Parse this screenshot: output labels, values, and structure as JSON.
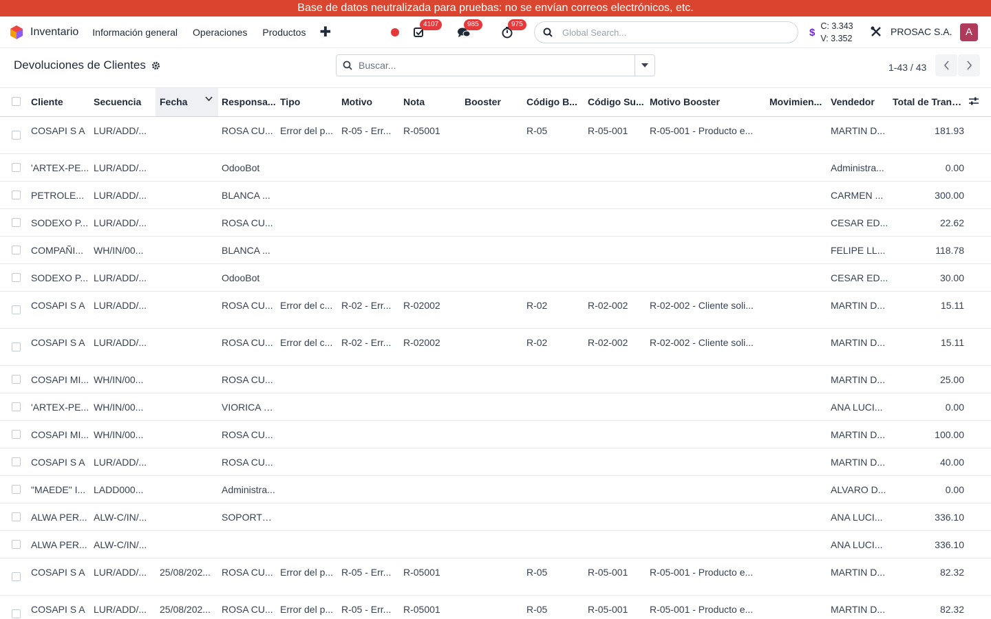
{
  "banner": "Base de datos neutralizada para pruebas: no se envían correos electrónicos, etc.",
  "navbar": {
    "app_name": "Inventario",
    "menu": [
      "Información general",
      "Operaciones",
      "Productos"
    ],
    "badges": {
      "activities": "4107",
      "messages": "985",
      "timesheets": "975"
    },
    "global_search_placeholder": "Global Search...",
    "rate_c": "C: 3.343",
    "rate_v": "V: 3.352",
    "company": "PROSAC S.A.",
    "avatar_letter": "A"
  },
  "control": {
    "title": "Devoluciones de Clientes",
    "search_placeholder": "Buscar...",
    "pager": "1-43 / 43"
  },
  "columns": [
    "Cliente",
    "Secuencia",
    "Fecha",
    "Responsa...",
    "Tipo",
    "Motivo",
    "Nota",
    "Booster",
    "Código B...",
    "Código Su...",
    "Motivo Booster",
    "Movimien...",
    "Vendedor",
    "Total de Trans..."
  ],
  "rows": [
    {
      "c": "COSAPI S A",
      "s": "LUR/ADD/...",
      "f": "",
      "r": "ROSA CU...",
      "t": "Error del p...",
      "m": "R-05 - Err...",
      "n": "R-05001",
      "b": "",
      "cb": "R-05",
      "cs": "R-05-001",
      "mb": "R-05-001 - Producto e...",
      "mv": "",
      "v": "MARTIN D...",
      "tot": "181.93",
      "tall": true
    },
    {
      "c": "'ARTEX-PE...",
      "s": "LUR/ADD/...",
      "f": "",
      "r": "OdooBot",
      "t": "",
      "m": "",
      "n": "",
      "b": "",
      "cb": "",
      "cs": "",
      "mb": "",
      "mv": "",
      "v": "Administra...",
      "tot": "0.00",
      "tall": false
    },
    {
      "c": "PETROLE...",
      "s": "LUR/ADD/...",
      "f": "",
      "r": "BLANCA ...",
      "t": "",
      "m": "",
      "n": "",
      "b": "",
      "cb": "",
      "cs": "",
      "mb": "",
      "mv": "",
      "v": "CARMEN ...",
      "tot": "300.00",
      "tall": false
    },
    {
      "c": "SODEXO P...",
      "s": "LUR/ADD/...",
      "f": "",
      "r": "ROSA CU...",
      "t": "",
      "m": "",
      "n": "",
      "b": "",
      "cb": "",
      "cs": "",
      "mb": "",
      "mv": "",
      "v": "CESAR ED...",
      "tot": "22.62",
      "tall": false
    },
    {
      "c": "COMPAÑI...",
      "s": "WH/IN/00...",
      "f": "",
      "r": "BLANCA ...",
      "t": "",
      "m": "",
      "n": "",
      "b": "",
      "cb": "",
      "cs": "",
      "mb": "",
      "mv": "",
      "v": "FELIPE LL...",
      "tot": "118.78",
      "tall": false
    },
    {
      "c": "SODEXO P...",
      "s": "LUR/ADD/...",
      "f": "",
      "r": "OdooBot",
      "t": "",
      "m": "",
      "n": "",
      "b": "",
      "cb": "",
      "cs": "",
      "mb": "",
      "mv": "",
      "v": "CESAR ED...",
      "tot": "30.00",
      "tall": false
    },
    {
      "c": "COSAPI S A",
      "s": "LUR/ADD/...",
      "f": "",
      "r": "ROSA CU...",
      "t": "Error del c...",
      "m": "R-02 - Err...",
      "n": "R-02002",
      "b": "",
      "cb": "R-02",
      "cs": "R-02-002",
      "mb": "R-02-002 - Cliente soli...",
      "mv": "",
      "v": "MARTIN D...",
      "tot": "15.11",
      "tall": true
    },
    {
      "c": "COSAPI S A",
      "s": "LUR/ADD/...",
      "f": "",
      "r": "ROSA CU...",
      "t": "Error del c...",
      "m": "R-02 - Err...",
      "n": "R-02002",
      "b": "",
      "cb": "R-02",
      "cs": "R-02-002",
      "mb": "R-02-002 - Cliente soli...",
      "mv": "",
      "v": "MARTIN D...",
      "tot": "15.11",
      "tall": true
    },
    {
      "c": "COSAPI MI...",
      "s": "WH/IN/00...",
      "f": "",
      "r": "ROSA CU...",
      "t": "",
      "m": "",
      "n": "",
      "b": "",
      "cb": "",
      "cs": "",
      "mb": "",
      "mv": "",
      "v": "MARTIN D...",
      "tot": "25.00",
      "tall": false
    },
    {
      "c": "'ARTEX-PE...",
      "s": "WH/IN/00...",
      "f": "",
      "r": "VIORICA P...",
      "t": "",
      "m": "",
      "n": "",
      "b": "",
      "cb": "",
      "cs": "",
      "mb": "",
      "mv": "",
      "v": "ANA LUCI...",
      "tot": "0.00",
      "tall": false
    },
    {
      "c": "COSAPI MI...",
      "s": "WH/IN/00...",
      "f": "",
      "r": "ROSA CU...",
      "t": "",
      "m": "",
      "n": "",
      "b": "",
      "cb": "",
      "cs": "",
      "mb": "",
      "mv": "",
      "v": "MARTIN D...",
      "tot": "100.00",
      "tall": false
    },
    {
      "c": "COSAPI S A",
      "s": "LUR/ADD/...",
      "f": "",
      "r": "ROSA CU...",
      "t": "",
      "m": "",
      "n": "",
      "b": "",
      "cb": "",
      "cs": "",
      "mb": "",
      "mv": "",
      "v": "MARTIN D...",
      "tot": "40.00",
      "tall": false
    },
    {
      "c": "\"MAEDE\" I...",
      "s": "LADD000...",
      "f": "",
      "r": "Administra...",
      "t": "",
      "m": "",
      "n": "",
      "b": "",
      "cb": "",
      "cs": "",
      "mb": "",
      "mv": "",
      "v": "ALVARO D...",
      "tot": "0.00",
      "tall": false
    },
    {
      "c": "ALWA PER...",
      "s": "ALW-C/IN/...",
      "f": "",
      "r": "SOPORTE ...",
      "t": "",
      "m": "",
      "n": "",
      "b": "",
      "cb": "",
      "cs": "",
      "mb": "",
      "mv": "",
      "v": "ANA LUCI...",
      "tot": "336.10",
      "tall": false
    },
    {
      "c": "ALWA PER...",
      "s": "ALW-C/IN/...",
      "f": "",
      "r": "",
      "t": "",
      "m": "",
      "n": "",
      "b": "",
      "cb": "",
      "cs": "",
      "mb": "",
      "mv": "",
      "v": "ANA LUCI...",
      "tot": "336.10",
      "tall": false
    },
    {
      "c": "COSAPI S A",
      "s": "LUR/ADD/...",
      "f": "25/08/202...",
      "r": "ROSA CU...",
      "t": "Error del p...",
      "m": "R-05 - Err...",
      "n": "R-05001",
      "b": "",
      "cb": "R-05",
      "cs": "R-05-001",
      "mb": "R-05-001 - Producto e...",
      "mv": "",
      "v": "MARTIN D...",
      "tot": "82.32",
      "tall": true
    },
    {
      "c": "COSAPI S A",
      "s": "LUR/ADD/...",
      "f": "25/08/202...",
      "r": "ROSA CU...",
      "t": "Error del p...",
      "m": "R-05 - Err...",
      "n": "R-05001",
      "b": "",
      "cb": "R-05",
      "cs": "R-05-001",
      "mb": "R-05-001 - Producto e...",
      "mv": "",
      "v": "MARTIN D...",
      "tot": "82.32",
      "tall": true
    }
  ]
}
